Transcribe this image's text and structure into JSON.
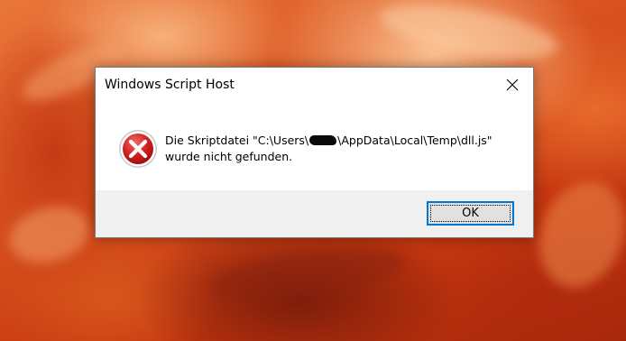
{
  "dialog": {
    "title": "Windows Script Host",
    "message_part1": "Die Skriptdatei \"C:\\Users\\",
    "message_part2": "\\AppData\\Local\\Temp\\dll.js\"",
    "message_line2": "wurde nicht gefunden.",
    "ok_label": "OK",
    "icon": "error-icon",
    "close_icon": "close-icon"
  },
  "colors": {
    "accent_focus": "#0078d7",
    "error_red": "#d21f1f",
    "footer_bg": "#f0f0f0"
  }
}
